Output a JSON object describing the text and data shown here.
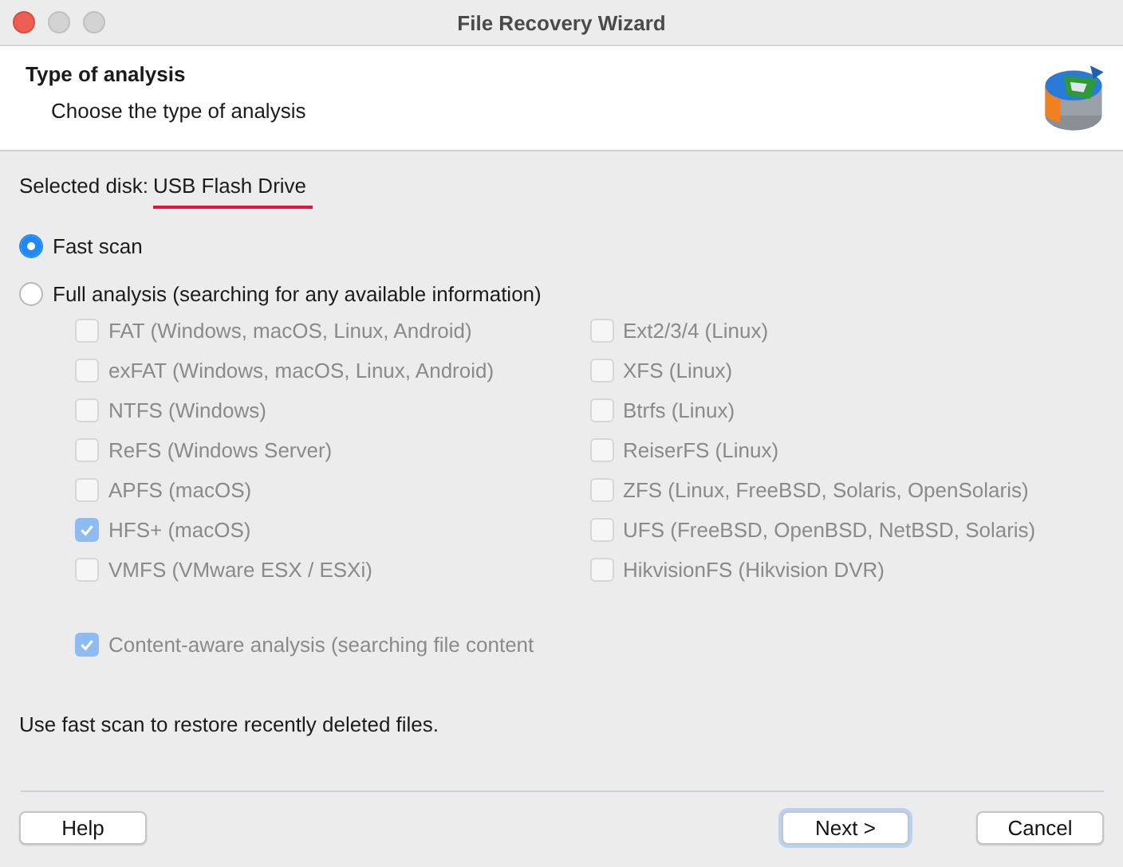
{
  "window": {
    "title": "File Recovery Wizard"
  },
  "header": {
    "title": "Type of analysis",
    "subtitle": "Choose the type of analysis"
  },
  "disk": {
    "label": "Selected disk:",
    "value": "USB Flash Drive"
  },
  "modes": [
    {
      "label": "Fast scan",
      "selected": true
    },
    {
      "label": "Full analysis (searching for any available information)",
      "selected": false
    }
  ],
  "filesystems_left": [
    {
      "label": "FAT (Windows, macOS, Linux, Android)",
      "checked": false,
      "disabled": true
    },
    {
      "label": "exFAT (Windows, macOS, Linux, Android)",
      "checked": false,
      "disabled": true
    },
    {
      "label": "NTFS (Windows)",
      "checked": false,
      "disabled": true
    },
    {
      "label": "ReFS (Windows Server)",
      "checked": false,
      "disabled": true
    },
    {
      "label": "APFS (macOS)",
      "checked": false,
      "disabled": true
    },
    {
      "label": "HFS+ (macOS)",
      "checked": true,
      "disabled": true
    },
    {
      "label": "VMFS (VMware ESX / ESXi)",
      "checked": false,
      "disabled": true
    }
  ],
  "filesystems_right": [
    {
      "label": "Ext2/3/4 (Linux)",
      "checked": false,
      "disabled": true
    },
    {
      "label": "XFS (Linux)",
      "checked": false,
      "disabled": true
    },
    {
      "label": "Btrfs (Linux)",
      "checked": false,
      "disabled": true
    },
    {
      "label": "ReiserFS (Linux)",
      "checked": false,
      "disabled": true
    },
    {
      "label": "ZFS (Linux, FreeBSD, Solaris, OpenSolaris)",
      "checked": false,
      "disabled": true
    },
    {
      "label": "UFS (FreeBSD, OpenBSD, NetBSD, Solaris)",
      "checked": false,
      "disabled": true
    },
    {
      "label": "HikvisionFS (Hikvision DVR)",
      "checked": false,
      "disabled": true
    }
  ],
  "content_aware": {
    "label": "Content-aware analysis (searching file content",
    "checked": true,
    "disabled": true
  },
  "hint": "Use fast scan to restore recently deleted files.",
  "buttons": [
    {
      "label": "Help",
      "focused": false
    },
    {
      "label": "Next >",
      "focused": true
    },
    {
      "label": "Cancel",
      "focused": false
    }
  ]
}
